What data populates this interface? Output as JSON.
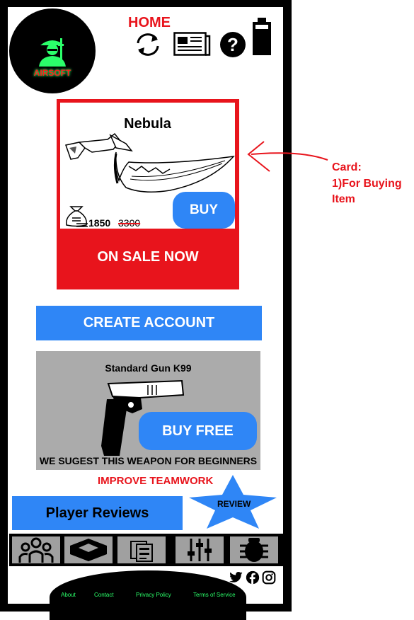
{
  "header": {
    "logo_text": "AIRSOFT",
    "title": "HOME",
    "icons": [
      "refresh-icon",
      "news-icon",
      "help-icon",
      "battery-icon"
    ]
  },
  "card": {
    "title": "Nebula",
    "price": "1850",
    "old_price": "3300",
    "buy_label": "BUY",
    "sale_label": "ON SALE NOW"
  },
  "create_account_label": "CREATE ACCOUNT",
  "gun_offer": {
    "title": "Standard Gun K99",
    "buy_label": "BUY FREE",
    "suggestion": "WE SUGEST THIS WEAPON FOR BEGINNERS"
  },
  "teamwork_label": "IMPROVE TEAMWORK",
  "player_reviews_label": "Player Reviews",
  "review_star_label": "REVIEW",
  "tabs": [
    "team-icon",
    "crate-icon",
    "clipboard-icon",
    "sliders-icon",
    "bug-icon"
  ],
  "social": [
    "twitter-icon",
    "facebook-icon",
    "instagram-icon"
  ],
  "footer_links": [
    "About",
    "Contact",
    "Privacy Policy",
    "Terms of Service"
  ],
  "annotation": {
    "line1": "Card:",
    "line2": "1)For Buying",
    "line3": "Item"
  },
  "colors": {
    "accent_red": "#e8141c",
    "button_blue": "#2f86f6",
    "neon_green": "#2bff6a",
    "panel_gray": "#ababab"
  }
}
